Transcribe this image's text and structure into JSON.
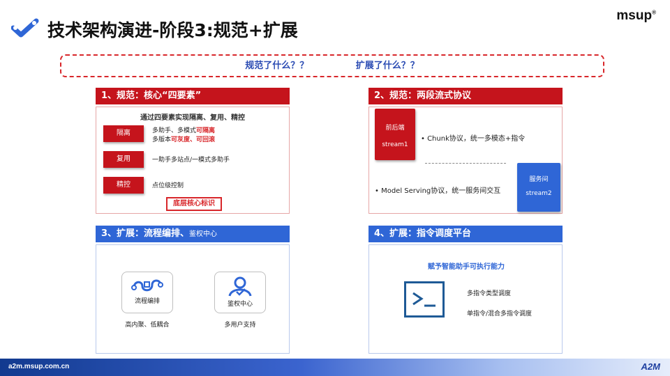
{
  "header": {
    "title": "技术架构演进-阶段3:规范+扩展",
    "brand": "msup",
    "brand_mark": "®"
  },
  "banner": {
    "text": "规范了什么？？   扩展了什么？？"
  },
  "panel1": {
    "title": "1、规范：核心“四要素”",
    "subtitle": "通过四要素实现隔离、复用、精控",
    "rows": [
      {
        "label": "隔离",
        "line1_pre": "多助手、多模式",
        "line1_hl": "可隔离",
        "line2_pre": "多版本",
        "line2_hl": "可灰度、可回滚"
      },
      {
        "label": "复用",
        "desc": "一助手多站点/一模式多助手"
      },
      {
        "label": "精控",
        "desc": "点位级控制"
      }
    ],
    "core_label": "底层核心标识"
  },
  "panel2": {
    "title": "2、规范：两段流式协议",
    "card1": {
      "name": "前后端",
      "stream": "stream1"
    },
    "bullet1": "•   Chunk协议，统一多模态+指令",
    "bullet2": "•   Model Serving协议，统一服务间交互",
    "card2": {
      "name": "服务间",
      "stream": "stream2"
    }
  },
  "panel3": {
    "title_main": "3、扩展：流程编排、",
    "title_small": "鉴权中心",
    "items": [
      {
        "icon": "flow-orchestration-icon",
        "label": "流程编排",
        "caption": "高内聚、低耦合"
      },
      {
        "icon": "auth-user-icon",
        "label": "鉴权中心",
        "caption": "多用户支持"
      }
    ]
  },
  "panel4": {
    "title": "4、扩展：指令调度平台",
    "subtitle": "赋予智能助手可执行能力",
    "items": [
      "多指令类型调度",
      "单指令/混合多指令调度"
    ]
  },
  "footer": {
    "url": "a2m.msup.com.cn",
    "logo": "A2M"
  },
  "colors": {
    "red": "#c5141c",
    "blue": "#2f66d6",
    "navy": "#1e5a96"
  }
}
